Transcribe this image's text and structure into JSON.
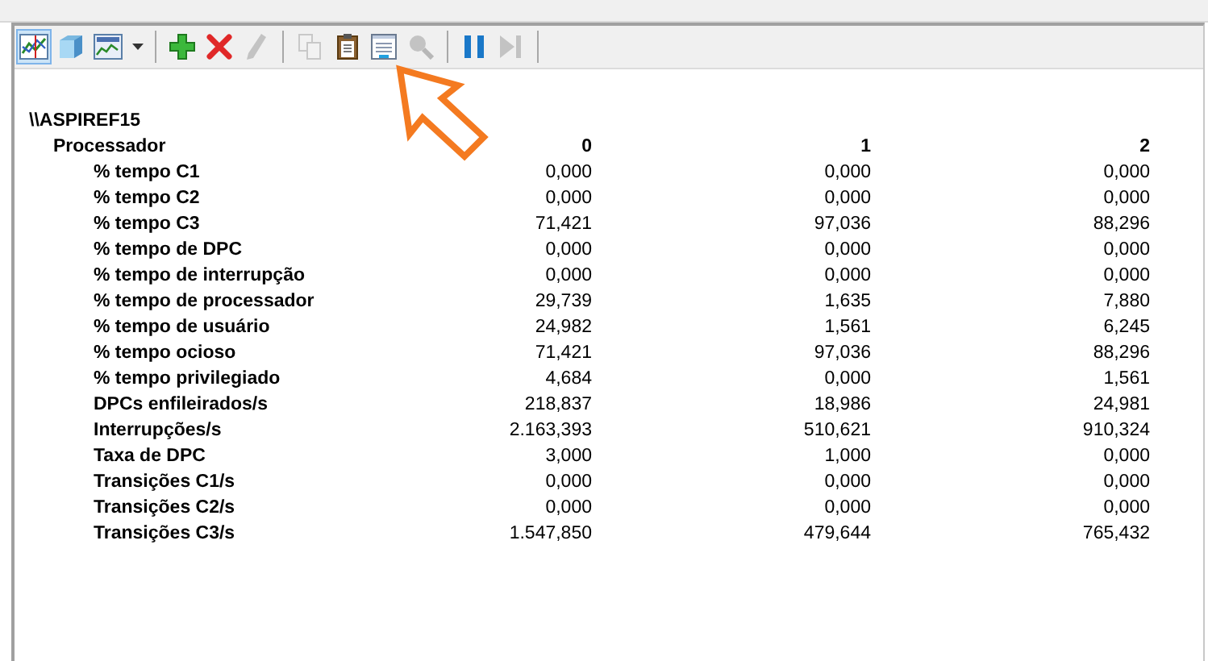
{
  "view_buttons": [
    {
      "kind": "line-chart",
      "selected": true
    },
    {
      "kind": "cube",
      "selected": false
    },
    {
      "kind": "histogram",
      "selected": false
    }
  ],
  "toolbar_groups": [
    {
      "buttons": [
        {
          "kind": "dropdown",
          "disabled": false
        }
      ]
    },
    {
      "buttons": [
        {
          "kind": "add",
          "disabled": false
        },
        {
          "kind": "delete",
          "disabled": false
        },
        {
          "kind": "pencil",
          "disabled": true
        }
      ]
    },
    {
      "buttons": [
        {
          "kind": "copy",
          "disabled": true
        },
        {
          "kind": "paste",
          "disabled": false
        },
        {
          "kind": "properties",
          "disabled": false
        },
        {
          "kind": "zoom",
          "disabled": true
        }
      ]
    },
    {
      "buttons": [
        {
          "kind": "pause",
          "disabled": false
        },
        {
          "kind": "step",
          "disabled": true
        }
      ]
    }
  ],
  "report": {
    "computer": "\\\\ASPIREF15",
    "object": "Processador",
    "instances": [
      "0",
      "1",
      "2"
    ],
    "counters": [
      {
        "name": "% tempo C1",
        "values": [
          "0,000",
          "0,000",
          "0,000"
        ]
      },
      {
        "name": "% tempo C2",
        "values": [
          "0,000",
          "0,000",
          "0,000"
        ]
      },
      {
        "name": "% tempo C3",
        "values": [
          "71,421",
          "97,036",
          "88,296"
        ]
      },
      {
        "name": "% tempo de DPC",
        "values": [
          "0,000",
          "0,000",
          "0,000"
        ]
      },
      {
        "name": "% tempo de interrupção",
        "values": [
          "0,000",
          "0,000",
          "0,000"
        ]
      },
      {
        "name": "% tempo de processador",
        "values": [
          "29,739",
          "1,635",
          "7,880"
        ]
      },
      {
        "name": "% tempo de usuário",
        "values": [
          "24,982",
          "1,561",
          "6,245"
        ]
      },
      {
        "name": "% tempo ocioso",
        "values": [
          "71,421",
          "97,036",
          "88,296"
        ]
      },
      {
        "name": "% tempo privilegiado",
        "values": [
          "4,684",
          "0,000",
          "1,561"
        ]
      },
      {
        "name": "DPCs enfileirados/s",
        "values": [
          "218,837",
          "18,986",
          "24,981"
        ]
      },
      {
        "name": "Interrupções/s",
        "values": [
          "2.163,393",
          "510,621",
          "910,324"
        ]
      },
      {
        "name": "Taxa de DPC",
        "values": [
          "3,000",
          "1,000",
          "0,000"
        ]
      },
      {
        "name": "Transições C1/s",
        "values": [
          "0,000",
          "0,000",
          "0,000"
        ]
      },
      {
        "name": "Transições C2/s",
        "values": [
          "0,000",
          "0,000",
          "0,000"
        ]
      },
      {
        "name": "Transições C3/s",
        "values": [
          "1.547,850",
          "479,644",
          "765,432"
        ]
      }
    ]
  }
}
